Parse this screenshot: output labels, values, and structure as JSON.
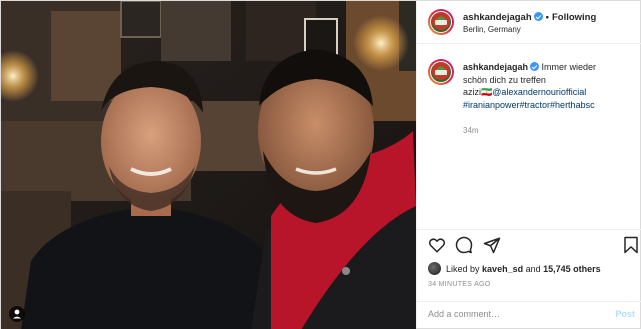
{
  "header": {
    "username": "ashkandejagah",
    "separator": "•",
    "follow_label": "Following",
    "location": "Berlin, Germany"
  },
  "caption": {
    "username": "ashkandejagah",
    "text_line1": "Immer wieder",
    "text_line2": "schön dich zu treffen",
    "text_line3_prefix": "azizi🇮🇷",
    "mention": "@alexandernourіofficial",
    "hashtags": "#iranianpower#tractor#herthabsc",
    "time_ago": "34m"
  },
  "actions": {
    "like_icon": "heart-icon",
    "comment_icon": "comment-bubble-icon",
    "share_icon": "paper-plane-icon",
    "save_icon": "bookmark-icon"
  },
  "likes": {
    "prefix": "Liked by",
    "liker": "kaveh_sd",
    "and": "and",
    "others": "15,745 others"
  },
  "post_time": "34 MINUTES AGO",
  "comment": {
    "placeholder": "Add a comment…",
    "post_label": "Post"
  },
  "colors": {
    "link": "#00376b",
    "verified": "#3897f0",
    "muted": "#8e8e8e",
    "post_disabled": "#b2dffc"
  }
}
